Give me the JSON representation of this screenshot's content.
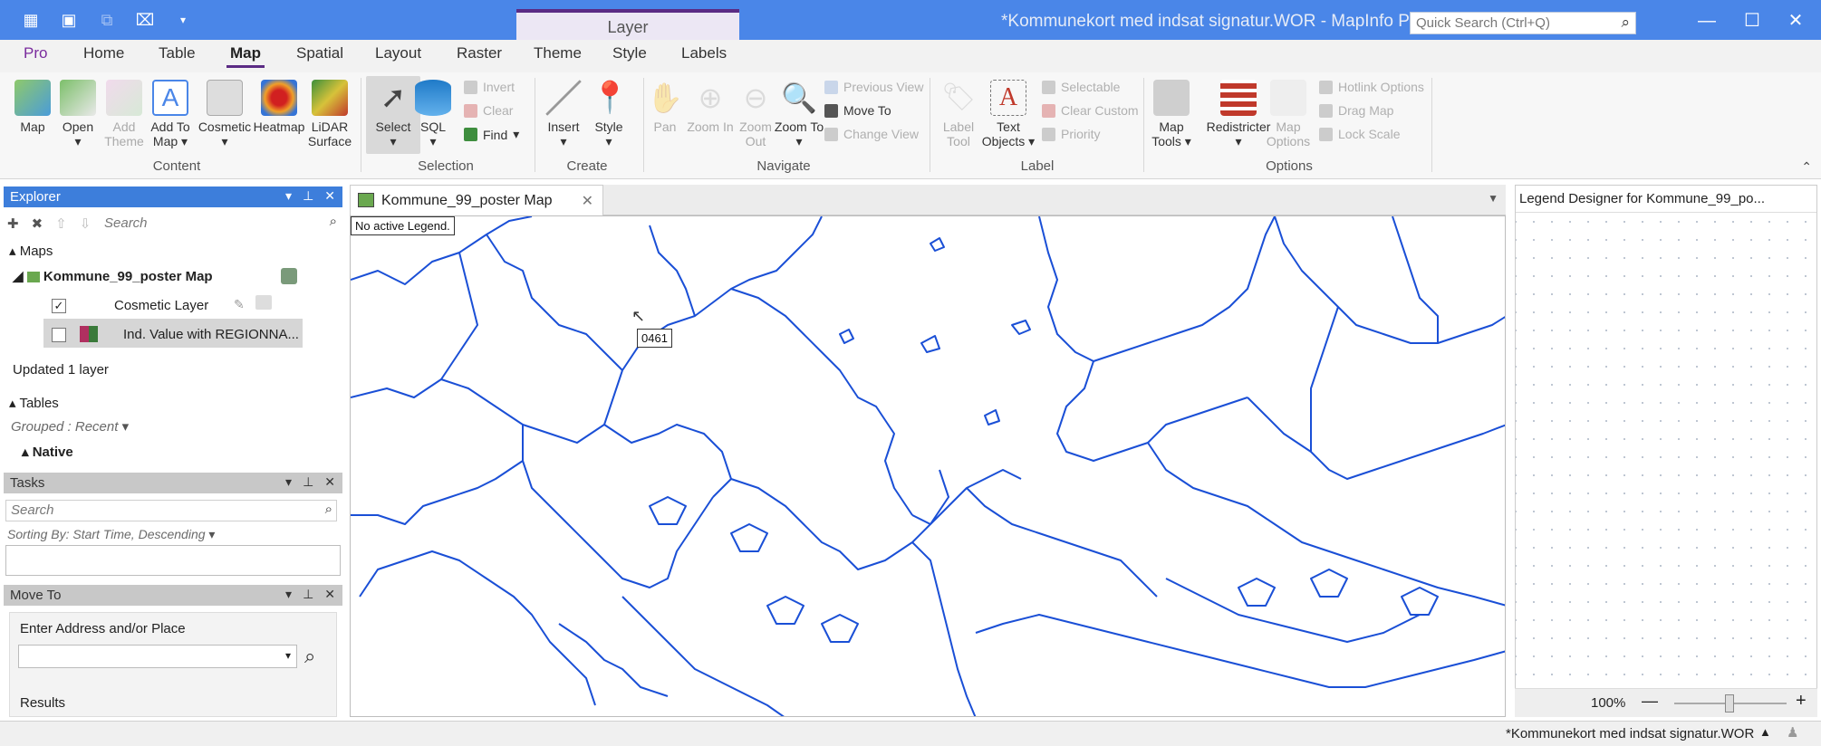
{
  "title_bar": {
    "window_title": "*Kommunekort med indsat signatur.WOR - MapInfo Pro",
    "context_group": "Layer",
    "quick_search_placeholder": "Quick Search (Ctrl+Q)",
    "accent": "#4a86e8"
  },
  "ribbon_tabs": [
    "Pro",
    "Home",
    "Table",
    "Map",
    "Spatial",
    "Layout",
    "Raster",
    "Theme",
    "Style",
    "Labels"
  ],
  "active_tab": "Map",
  "ribbon": {
    "content": {
      "label": "Content",
      "map": "Map",
      "open": "Open",
      "add_theme": "Add Theme",
      "add_to_map": "Add To Map",
      "cosmetic": "Cosmetic",
      "heatmap": "Heatmap",
      "lidar": "LiDAR Surface"
    },
    "selection": {
      "label": "Selection",
      "select": "Select",
      "sql": "SQL",
      "invert": "Invert",
      "clear": "Clear",
      "find": "Find"
    },
    "create": {
      "label": "Create",
      "insert": "Insert",
      "style": "Style"
    },
    "navigate": {
      "label": "Navigate",
      "pan": "Pan",
      "zoom_in": "Zoom In",
      "zoom_out": "Zoom Out",
      "zoom_to": "Zoom To",
      "previous_view": "Previous View",
      "move_to": "Move To",
      "change_view": "Change View"
    },
    "label_group": {
      "label": "Label",
      "label_tool": "Label Tool",
      "text_objects": "Text Objects",
      "selectable": "Selectable",
      "clear_custom": "Clear Custom",
      "priority": "Priority"
    },
    "options": {
      "label": "Options",
      "map_tools": "Map Tools",
      "redistricter": "Redistricter",
      "map_options": "Map Options",
      "hotlink_options": "Hotlink Options",
      "drag_map": "Drag Map",
      "lock_scale": "Lock Scale"
    }
  },
  "explorer": {
    "title": "Explorer",
    "search_placeholder": "Search",
    "maps_header": "Maps",
    "map_name": "Kommune_99_poster Map",
    "layers": [
      {
        "name": "Cosmetic Layer",
        "checked": true
      },
      {
        "name": "Ind. Value with REGIONNA...",
        "checked": false
      }
    ],
    "status": "Updated 1 layer",
    "tables_header": "Tables",
    "grouped": "Grouped : Recent",
    "native": "Native"
  },
  "tasks": {
    "title": "Tasks",
    "search_placeholder": "Search",
    "sorting": "Sorting By: Start Time, Descending"
  },
  "move_to": {
    "title": "Move To",
    "address_label": "Enter Address and/or Place",
    "results": "Results"
  },
  "document": {
    "tab_title": "Kommune_99_poster Map",
    "legend_note": "No active Legend.",
    "cursor_tooltip": "0461"
  },
  "legend_designer": {
    "title": "Legend Designer for Kommune_99_po...",
    "zoom": "100%"
  },
  "status_bar": {
    "workspace": "*Kommunekort med indsat signatur.WOR"
  }
}
